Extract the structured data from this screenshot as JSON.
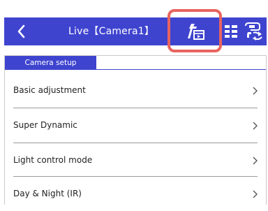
{
  "header": {
    "title": "Live【Camera1】",
    "background_color": "#3f44cf",
    "highlight_color": "#e9645f",
    "icons": {
      "back": "chevron-left-icon",
      "setup": "camera-setup-icon",
      "grid": "grid-view-icon",
      "switch": "camera-switch-icon"
    }
  },
  "section": {
    "title": "Camera setup"
  },
  "menu": {
    "items": [
      {
        "label": "Basic adjustment"
      },
      {
        "label": "Super Dynamic"
      },
      {
        "label": "Light control mode"
      },
      {
        "label": "Day & Night (IR)"
      }
    ]
  }
}
